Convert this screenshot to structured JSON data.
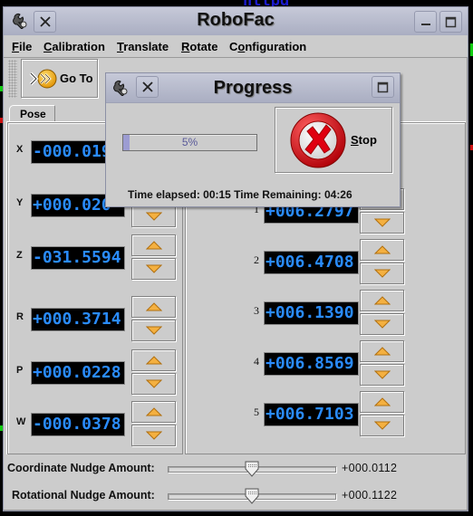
{
  "desktop": {
    "background_text": "httpd"
  },
  "window": {
    "title": "RoboFac"
  },
  "menu": {
    "items": [
      {
        "label": "File",
        "mnemonic_index": 0
      },
      {
        "label": "Calibration",
        "mnemonic_index": 0
      },
      {
        "label": "Translate",
        "mnemonic_index": 0
      },
      {
        "label": "Rotate",
        "mnemonic_index": 0
      },
      {
        "label": "Configuration",
        "mnemonic_index": 1
      }
    ]
  },
  "toolbar": {
    "goto_label": "Go To"
  },
  "tabs": [
    {
      "label": "Pose",
      "selected": true
    }
  ],
  "pose": {
    "coordinates": [
      {
        "axis": "X",
        "value": "-000.019"
      },
      {
        "axis": "Y",
        "value": "+000.020"
      },
      {
        "axis": "Z",
        "value": "-031.5594"
      },
      {
        "axis": "R",
        "value": "+000.3714"
      },
      {
        "axis": "P",
        "value": "+000.0228"
      },
      {
        "axis": "W",
        "value": "-000.0378"
      }
    ],
    "joints": [
      {
        "index": "1",
        "value": "+006.2797"
      },
      {
        "index": "2",
        "value": "+006.4708"
      },
      {
        "index": "3",
        "value": "+006.1390"
      },
      {
        "index": "4",
        "value": "+006.8569"
      },
      {
        "index": "5",
        "value": "+006.7103"
      }
    ]
  },
  "sliders": {
    "coordinate": {
      "label": "Coordinate Nudge Amount:",
      "value": "+000.0112",
      "position_fraction": 0.5
    },
    "rotational": {
      "label": "Rotational Nudge Amount:",
      "value": "+000.1122",
      "position_fraction": 0.5
    }
  },
  "progress_dialog": {
    "title": "Progress",
    "percent": 5,
    "percent_label": "5%",
    "stop_label": "Stop",
    "stop_mnemonic_index": 0,
    "time_text": "Time elapsed: 00:15 Time Remaining: 04:26"
  },
  "colors": {
    "lcd_text": "#2a8cff",
    "lcd_background": "#000000",
    "progress_fill": "#9c9cd2",
    "stop_icon_red": "#e00010",
    "arrow_orange": "#f0a030"
  }
}
